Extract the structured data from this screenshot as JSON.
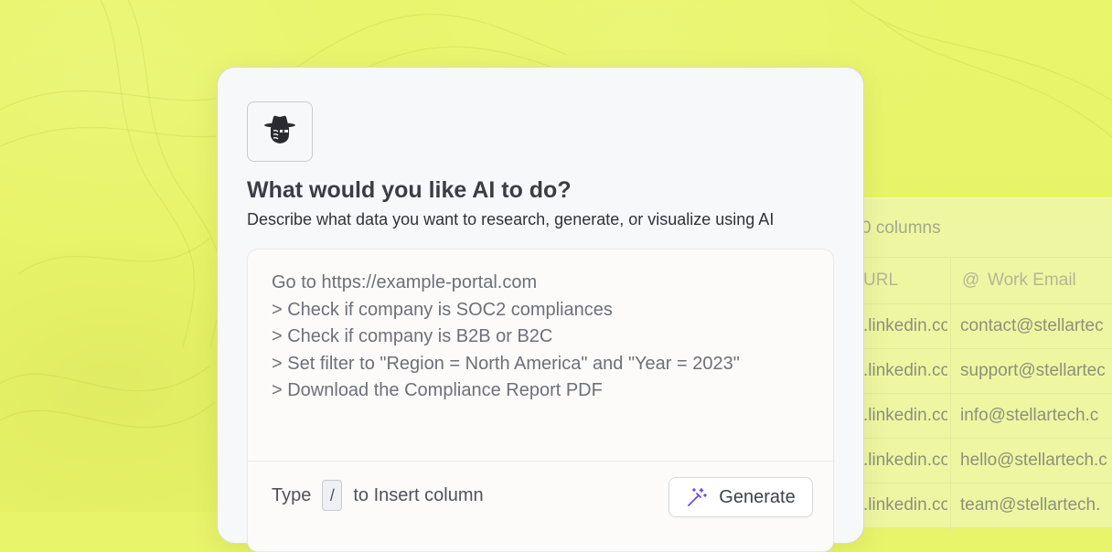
{
  "colors": {
    "background": "#e8f46a",
    "card": "#f7f8fa",
    "accent_icon": "#6a4fd8"
  },
  "background_table": {
    "columns_label": "0 columns",
    "headers": [
      "URL",
      "Work Email"
    ],
    "header_icon": "at-icon",
    "rows": [
      {
        "url": ".linkedin.co",
        "email": "contact@stellartec"
      },
      {
        "url": ".linkedin.co",
        "email": "support@stellartec"
      },
      {
        "url": ".linkedin.co",
        "email": "info@stellartech.c"
      },
      {
        "url": ".linkedin.co",
        "email": "hello@stellartech.c"
      },
      {
        "url": ".linkedin.co",
        "email": "team@stellartech."
      }
    ]
  },
  "card": {
    "logo_icon": "detective-hat-icon",
    "title": "What would you like AI to do?",
    "subtitle": "Describe what data you want to research, generate, or visualize using AI",
    "prompt": {
      "lines": [
        "Go to https://example-portal.com",
        "> Check if company is SOC2 compliances",
        "> Check if company is B2B or B2C",
        "> Set filter to \"Region = North America\" and \"Year = 2023\"",
        "> Download the Compliance Report PDF"
      ]
    },
    "hint": {
      "before": "Type",
      "key": "/",
      "after": "to Insert column"
    },
    "generate_button": {
      "label": "Generate",
      "icon": "magic-wand-icon"
    }
  }
}
